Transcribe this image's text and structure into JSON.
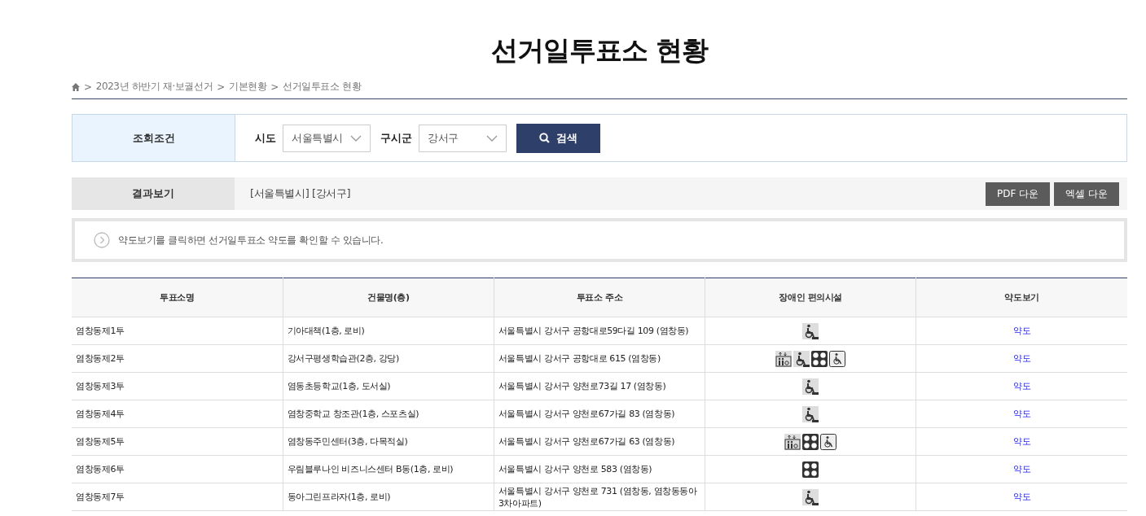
{
  "title": "선거일투표소 현황",
  "breadcrumb": [
    {
      "separator": ">",
      "label": "2023년 하반기 재·보궐선거"
    },
    {
      "separator": ">",
      "label": "기본현황"
    },
    {
      "separator": ">",
      "label": "선거일투표소 현황"
    }
  ],
  "search": {
    "label": "조회조건",
    "fields": [
      {
        "label": "시도",
        "value": "서울특별시"
      },
      {
        "label": "구시군",
        "value": "강서구"
      }
    ],
    "button": "검색"
  },
  "result": {
    "label": "결과보기",
    "text": "[서울특별시] [강서구]",
    "buttons": [
      "PDF 다운",
      "엑셀 다운"
    ]
  },
  "notice": "약도보기를 클릭하면 선거일투표소 약도를 확인할 수 있습니다.",
  "table": {
    "columns": [
      "투표소명",
      "건물명(층)",
      "투표소 주소",
      "장애인 편의시설",
      "약도보기"
    ],
    "rows": [
      {
        "name": "염창동제1투",
        "building": "기아대책(1층, 로비)",
        "address": "서울특별시 강서구 공항대로59다길 109 (염창동)",
        "facilities": [
          {
            "kind": "ramp"
          }
        ],
        "map": "약도"
      },
      {
        "name": "염창동제2투",
        "building": "강서구평생학습관(2층, 강당)",
        "address": "서울특별시 강서구 공항대로 615 (염창동)",
        "facilities": [
          {
            "kind": "elevator"
          },
          {
            "kind": "ramp"
          },
          {
            "kind": "dots"
          },
          {
            "kind": "wheelchair"
          }
        ],
        "map": "약도"
      },
      {
        "name": "염창동제3투",
        "building": "염동초등학교(1층, 도서실)",
        "address": "서울특별시 강서구 양천로73길 17 (염창동)",
        "facilities": [
          {
            "kind": "ramp"
          }
        ],
        "map": "약도"
      },
      {
        "name": "염창동제4투",
        "building": "염창중학교 창조관(1층, 스포츠실)",
        "address": "서울특별시 강서구 양천로67가길 83 (염창동)",
        "facilities": [
          {
            "kind": "ramp"
          }
        ],
        "map": "약도"
      },
      {
        "name": "염창동제5투",
        "building": "염창동주민센터(3층, 다목적실)",
        "address": "서울특별시 강서구 양천로67가길 63 (염창동)",
        "facilities": [
          {
            "kind": "elevator"
          },
          {
            "kind": "dots"
          },
          {
            "kind": "wheelchair"
          }
        ],
        "map": "약도"
      },
      {
        "name": "염창동제6투",
        "building": "우림블루나인 비즈니스센터 B동(1층, 로비)",
        "address": "서울특별시 강서구 양천로 583 (염창동)",
        "facilities": [
          {
            "kind": "dots"
          }
        ],
        "map": "약도"
      },
      {
        "name": "염창동제7투",
        "building": "동아그린프라자(1층, 로비)",
        "address": "서울특별시 강서구 양천로 731 (염창동, 염창동동아3차아파트)",
        "facilities": [
          {
            "kind": "ramp"
          }
        ],
        "map": "약도"
      }
    ]
  }
}
